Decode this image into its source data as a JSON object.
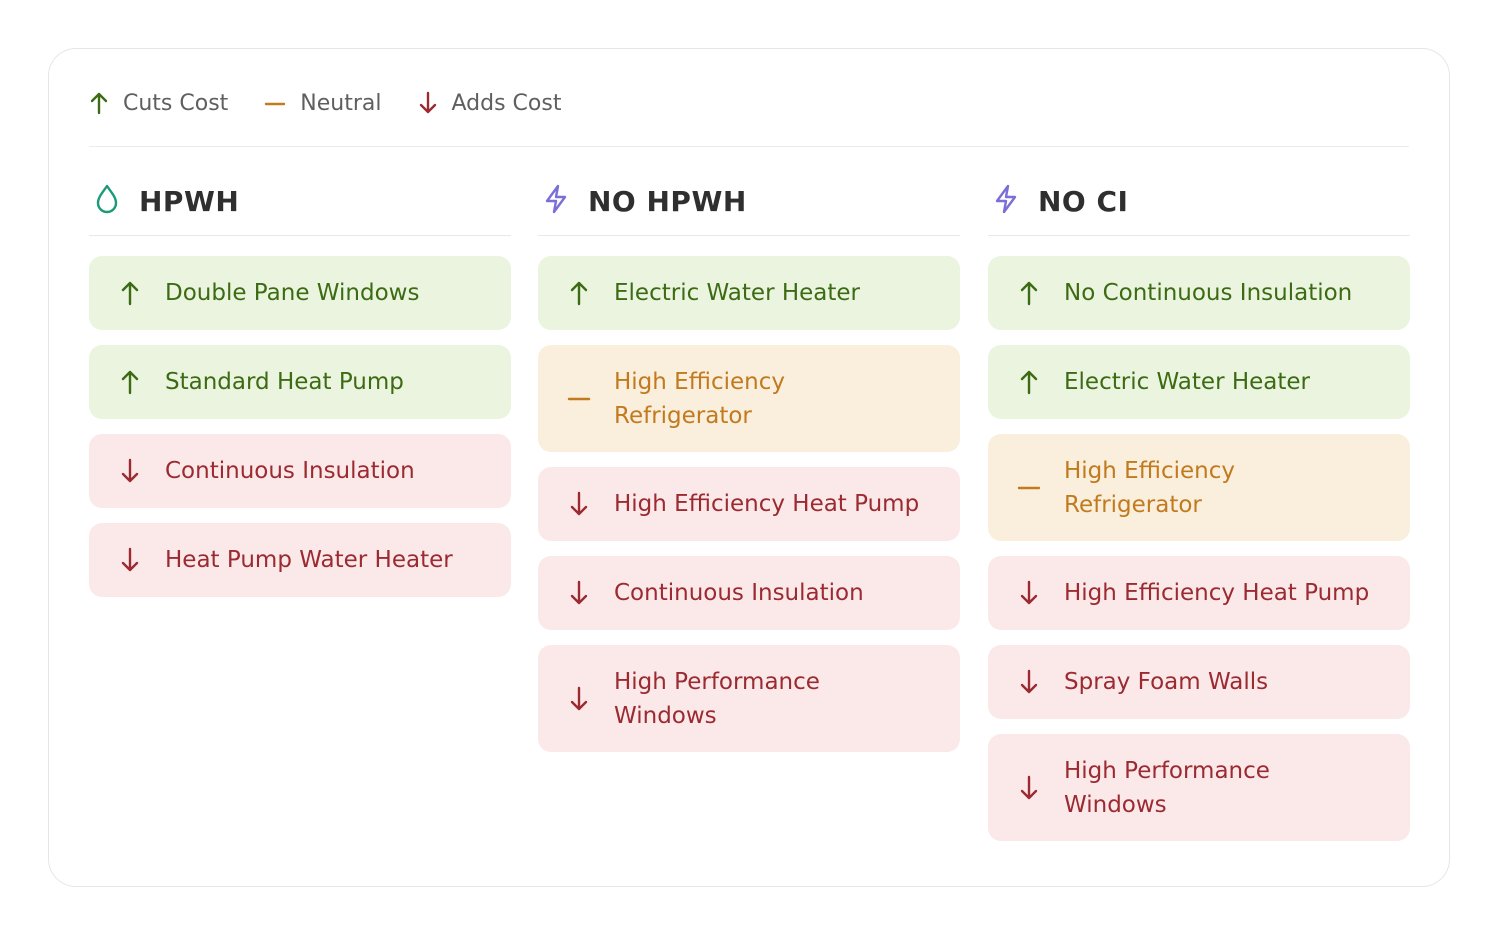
{
  "legend": {
    "cuts_label": "Cuts Cost",
    "neutral_label": "Neutral",
    "adds_label": "Adds Cost"
  },
  "colors": {
    "cuts": "#3d6b14",
    "cuts_bg": "#eaf4df",
    "neutral": "#c27a1e",
    "neutral_bg": "#faeedc",
    "adds": "#9b2a31",
    "adds_bg": "#fbe9ea",
    "drop_icon": "#1a9a7a",
    "bolt_icon": "#7a6fd6"
  },
  "columns": [
    {
      "title": "HPWH",
      "icon": "water-drop-icon",
      "items": [
        {
          "label": "Double Pane Windows",
          "effect": "cuts"
        },
        {
          "label": "Standard Heat Pump",
          "effect": "cuts"
        },
        {
          "label": "Continuous Insulation",
          "effect": "adds"
        },
        {
          "label": "Heat Pump Water Heater",
          "effect": "adds"
        }
      ]
    },
    {
      "title": "NO HPWH",
      "icon": "lightning-bolt-icon",
      "items": [
        {
          "label": "Electric Water Heater",
          "effect": "cuts"
        },
        {
          "label": "High Efficiency Refrigerator",
          "effect": "neutral"
        },
        {
          "label": "High Efficiency Heat Pump",
          "effect": "adds"
        },
        {
          "label": "Continuous Insulation",
          "effect": "adds"
        },
        {
          "label": "High Performance Windows",
          "effect": "adds"
        }
      ]
    },
    {
      "title": "NO CI",
      "icon": "lightning-bolt-icon",
      "items": [
        {
          "label": "No Continuous Insulation",
          "effect": "cuts"
        },
        {
          "label": "Electric Water Heater",
          "effect": "cuts"
        },
        {
          "label": "High Efficiency Refrigerator",
          "effect": "neutral"
        },
        {
          "label": "High Efficiency Heat Pump",
          "effect": "adds"
        },
        {
          "label": "Spray Foam Walls",
          "effect": "adds"
        },
        {
          "label": "High Performance Windows",
          "effect": "adds"
        }
      ]
    }
  ]
}
